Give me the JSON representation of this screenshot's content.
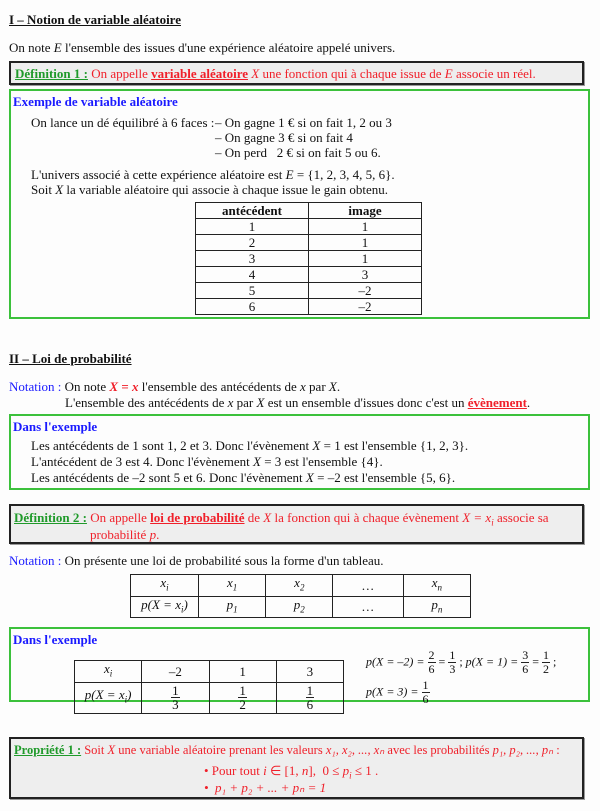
{
  "section1": {
    "title": "I – Notion de variable aléatoire",
    "intro_pre": "On note ",
    "intro_var": "E",
    "intro_post": " l'ensemble des issues d'une expérience aléatoire appelé univers."
  },
  "def1": {
    "label": "Définition 1 :",
    "t1": " On appelle ",
    "term": "variable aléatoire",
    "var": " X",
    "t2": " une fonction qui à chaque issue de ",
    "var2": "E",
    "t3": " associe un réel."
  },
  "example1": {
    "title": "Exemple de variable aléatoire",
    "lead": "On lance un dé équilibré à 6 faces :",
    "rules": [
      "– On gagne 1 € si on fait 1, 2 ou 3",
      "– On gagne 3 € si on fait 4",
      "– On perd   2 € si on fait 5 ou 6."
    ],
    "univers_pre": "L'univers associé à cette expérience aléatoire est ",
    "univers_var": "E",
    "univers_post": " = {1, 2, 3, 4, 5, 6}.",
    "soit_pre": "Soit ",
    "soit_var": "X",
    "soit_post": " la variable aléatoire qui associe à chaque issue le gain obtenu.",
    "table": {
      "headers": [
        "antécédent",
        "image"
      ],
      "rows": [
        [
          "1",
          "1"
        ],
        [
          "2",
          "1"
        ],
        [
          "3",
          "1"
        ],
        [
          "4",
          "3"
        ],
        [
          "5",
          "–2"
        ],
        [
          "6",
          "–2"
        ]
      ]
    }
  },
  "section2": {
    "title": "II – Loi de probabilité",
    "notation_label": "Notation :",
    "n1_pre": " On note ",
    "n1_expr": "X = x",
    "n1_mid": " l'ensemble des antécédents de ",
    "n1_x": "x",
    "n1_par": " par ",
    "n1_X": "X",
    "n1_end": ".",
    "n2_pre": "L'ensemble des antécédents de ",
    "n2_x": "x",
    "n2_par": " par ",
    "n2_X": "X",
    "n2_mid": " est un ensemble d'issues donc c'est un ",
    "n2_term": "évènement",
    "n2_end": "."
  },
  "example2": {
    "title": "Dans l'exemple",
    "lines": [
      {
        "pre": "Les antécédents de 1 sont 1, 2 et 3. Donc l'évènement ",
        "X": "X",
        "post": " = 1 est l'ensemble {1, 2, 3}."
      },
      {
        "pre": "L'antécédent de 3 est 4. Donc l'évènement ",
        "X": "X",
        "post": " = 3 est l'ensemble {4}."
      },
      {
        "pre": "Les antécédents de –2 sont 5 et 6. Donc l'évènement ",
        "X": "X",
        "post": " = –2 est l'ensemble {5, 6}."
      }
    ]
  },
  "def2": {
    "label": "Définition 2 :",
    "t1": " On appelle ",
    "term": "loi de probabilité",
    "t2": " de ",
    "var": "X",
    "t3": " la fonction qui à chaque évènement ",
    "expr": "X = x",
    "expr_sub": "i",
    "t4": " associe sa",
    "t5": "probabilité ",
    "p": "p",
    "t6": "."
  },
  "notation2": {
    "label": "Notation :",
    "text": " On présente une loi de probabilité sous la forme d'un tableau."
  },
  "general_table": {
    "row1": [
      {
        "b": "x",
        "s": "i"
      },
      {
        "b": "x",
        "s": "1"
      },
      {
        "b": "x",
        "s": "2"
      },
      {
        "b": "…",
        "s": ""
      },
      {
        "b": "x",
        "s": "n"
      }
    ],
    "row2": [
      {
        "b": "p(X = x",
        "s": "i",
        "e": ")"
      },
      {
        "b": "p",
        "s": "1"
      },
      {
        "b": "p",
        "s": "2"
      },
      {
        "b": "…",
        "s": ""
      },
      {
        "b": "p",
        "s": "n"
      }
    ]
  },
  "example3": {
    "title": "Dans l'exemple",
    "table": {
      "head_b": "x",
      "head_s": "i",
      "prob_b": "p(X = x",
      "prob_s": "i",
      "prob_e": ")",
      "values": [
        "–2",
        "1",
        "3"
      ],
      "probs": [
        {
          "n": "1",
          "d": "3"
        },
        {
          "n": "1",
          "d": "2"
        },
        {
          "n": "1",
          "d": "6"
        }
      ]
    },
    "calc": {
      "c1_lhs": "p(X = –2) = ",
      "c1_f1": {
        "n": "2",
        "d": "6"
      },
      "c1_f2": {
        "n": "1",
        "d": "3"
      },
      "sep": " ; ",
      "c2_lhs": "p(X = 1) = ",
      "c2_f1": {
        "n": "3",
        "d": "6"
      },
      "c2_f2": {
        "n": "1",
        "d": "2"
      },
      "end": " ;",
      "c3_lhs": "p(X = 3) = ",
      "c3_f1": {
        "n": "1",
        "d": "6"
      },
      "eq": " = "
    }
  },
  "prop1": {
    "label": "Propriété 1 :",
    "t1": " Soit ",
    "var": "X",
    "t2": " une variable aléatoire prenant les valeurs ",
    "vals": "x₁, x₂, ..., xₙ",
    "t3": " avec les probabilités ",
    "probs": "p₁, p₂, ..., pₙ",
    "t4": " :",
    "b1_pre": "• Pour tout ",
    "b1_i": "i",
    "b1_mid": " ∈ [1, ",
    "b1_n": "n",
    "b1_mid2": "],  0 ≤ ",
    "b1_p": "p",
    "b1_sub": "i",
    "b1_end": " ≤ 1 .",
    "b2": "•  p₁ + p₂ + ... + pₙ = 1"
  }
}
